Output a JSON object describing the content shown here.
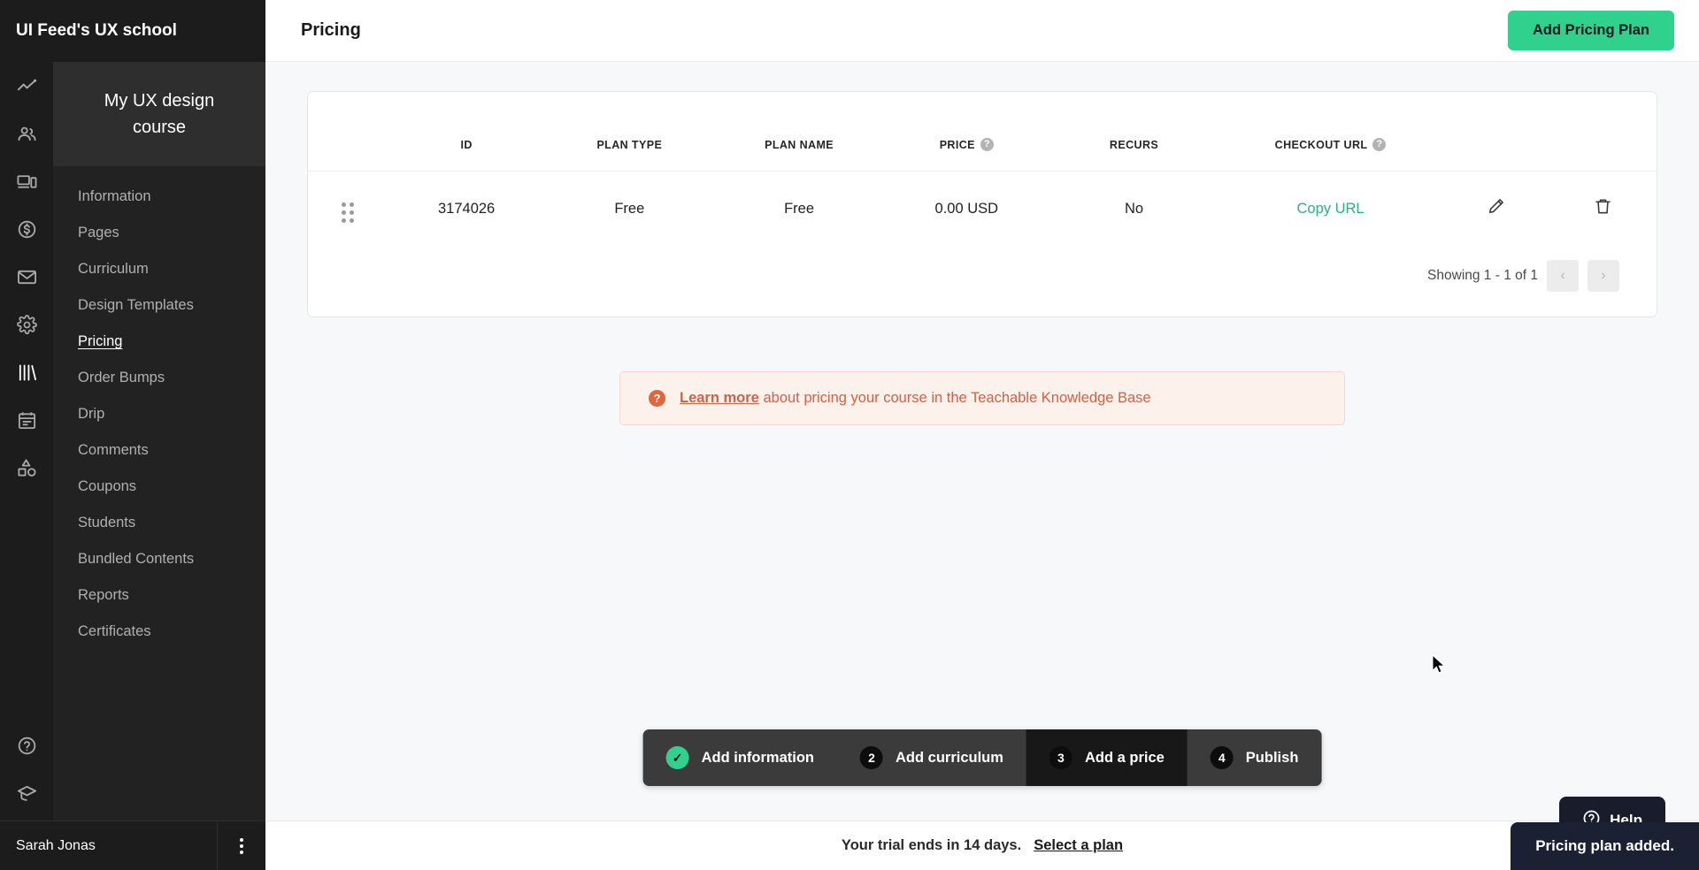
{
  "brand": {
    "name": "UI Feed's UX school"
  },
  "rail": {
    "icons": [
      {
        "name": "analytics-icon",
        "active": false
      },
      {
        "name": "users-icon",
        "active": false
      },
      {
        "name": "site-icon",
        "active": false
      },
      {
        "name": "sales-icon",
        "active": false
      },
      {
        "name": "email-icon",
        "active": false
      },
      {
        "name": "settings-icon",
        "active": false
      },
      {
        "name": "library-icon",
        "active": true
      },
      {
        "name": "notes-icon",
        "active": false
      },
      {
        "name": "shapes-icon",
        "active": false
      }
    ],
    "bottom": [
      {
        "name": "help-circle-icon"
      },
      {
        "name": "graduation-cap-icon"
      }
    ]
  },
  "sidebar": {
    "course_title": "My UX design course",
    "items": [
      {
        "label": "Information",
        "active": false
      },
      {
        "label": "Pages",
        "active": false
      },
      {
        "label": "Curriculum",
        "active": false
      },
      {
        "label": "Design Templates",
        "active": false
      },
      {
        "label": "Pricing",
        "active": true
      },
      {
        "label": "Order Bumps",
        "active": false
      },
      {
        "label": "Drip",
        "active": false
      },
      {
        "label": "Comments",
        "active": false
      },
      {
        "label": "Coupons",
        "active": false
      },
      {
        "label": "Students",
        "active": false
      },
      {
        "label": "Bundled Contents",
        "active": false
      },
      {
        "label": "Reports",
        "active": false
      },
      {
        "label": "Certificates",
        "active": false
      }
    ],
    "user": {
      "name": "Sarah Jonas"
    }
  },
  "header": {
    "title": "Pricing",
    "add_plan_label": "Add Pricing Plan"
  },
  "table": {
    "columns": [
      {
        "key": "handle",
        "label": "",
        "help": false
      },
      {
        "key": "id",
        "label": "ID",
        "help": false
      },
      {
        "key": "plan_type",
        "label": "PLAN TYPE",
        "help": false
      },
      {
        "key": "plan_name",
        "label": "PLAN NAME",
        "help": false
      },
      {
        "key": "price",
        "label": "PRICE",
        "help": true
      },
      {
        "key": "recurs",
        "label": "RECURS",
        "help": false
      },
      {
        "key": "checkout_url",
        "label": "CHECKOUT URL",
        "help": true
      }
    ],
    "rows": [
      {
        "id": "3174026",
        "plan_type": "Free",
        "plan_name": "Free",
        "price": "0.00 USD",
        "recurs": "No",
        "checkout_label": "Copy URL"
      }
    ],
    "help_glyph": "?",
    "pagination": {
      "showing": "Showing 1 - 1 of 1",
      "prev": "‹",
      "next": "›"
    }
  },
  "notice": {
    "icon_glyph": "?",
    "link_text": "Learn more",
    "rest_text": " about pricing your course in the Teachable Knowledge Base"
  },
  "stepper": {
    "steps": [
      {
        "badge": "✓",
        "label": "Add information",
        "state": "done"
      },
      {
        "badge": "2",
        "label": "Add curriculum",
        "state": "todo"
      },
      {
        "badge": "3",
        "label": "Add a price",
        "state": "current"
      },
      {
        "badge": "4",
        "label": "Publish",
        "state": "todo"
      }
    ]
  },
  "footer": {
    "trial_text": "Your trial ends in 14 days.",
    "select_plan_label": "Select a plan"
  },
  "help_fab": {
    "label": "Help"
  },
  "toast": {
    "message": "Pricing plan added."
  },
  "colors": {
    "accent_green": "#2fd18c",
    "link_green": "#2fae7e",
    "notice_orange": "#cf6343",
    "sidebar_bg": "#222222",
    "rail_bg": "#1c1c1c",
    "page_bg": "#f7f8fa"
  }
}
